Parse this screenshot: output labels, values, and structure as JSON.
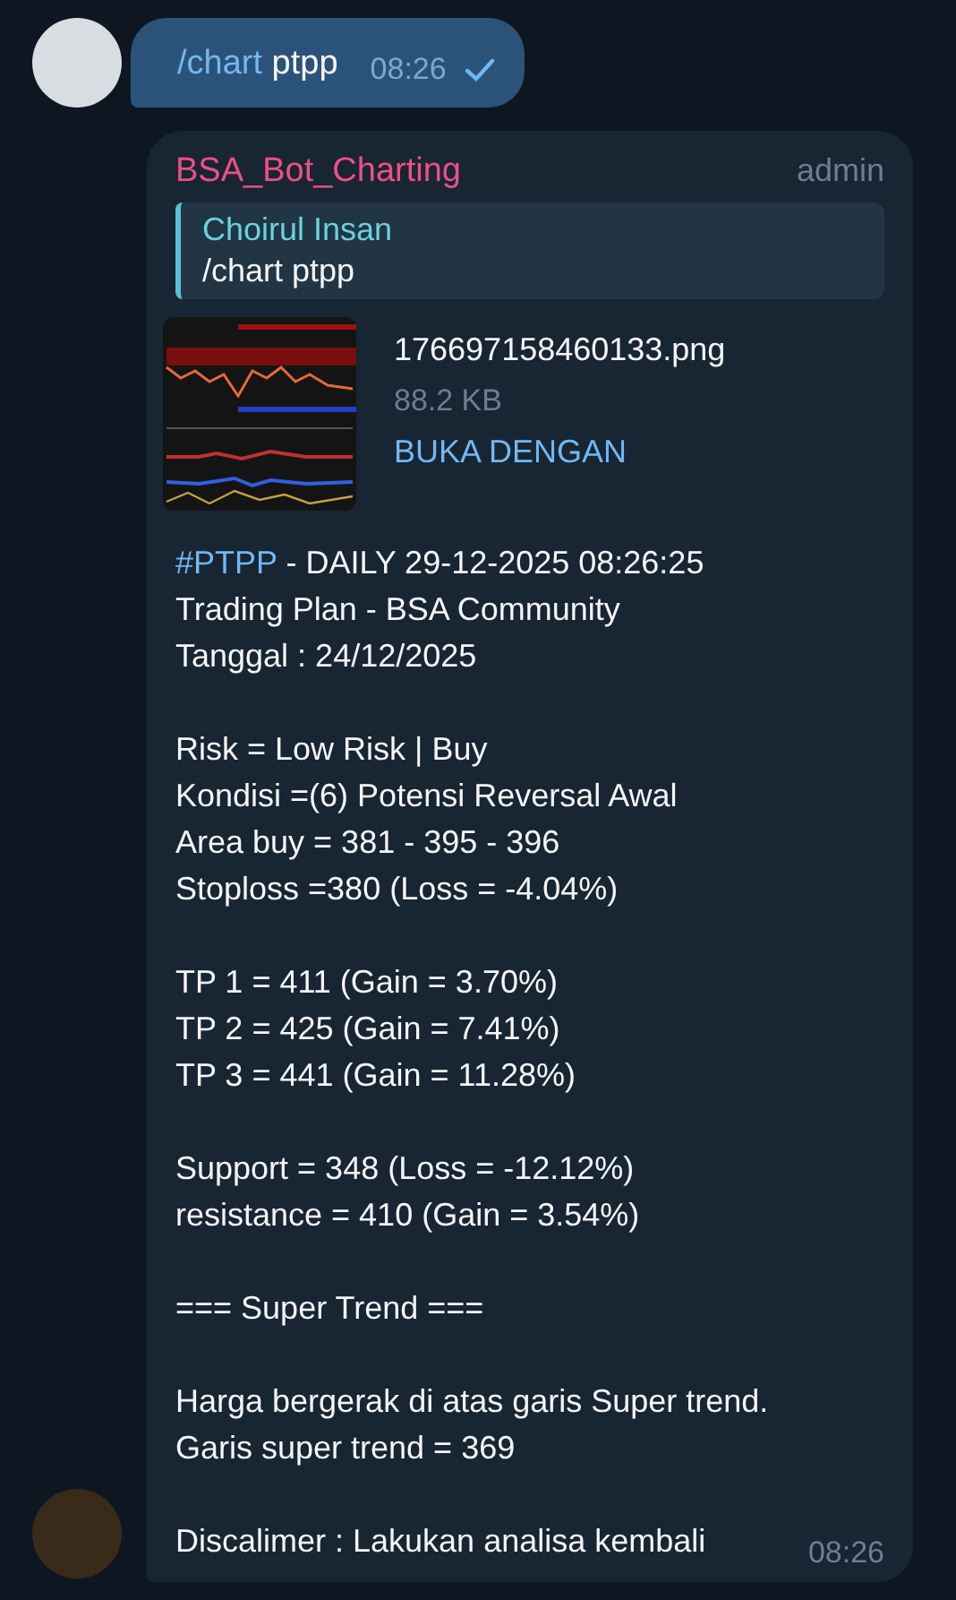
{
  "outgoing": {
    "command": "/chart",
    "text": "ptpp",
    "time": "08:26",
    "read": true
  },
  "incoming": {
    "sender": "BSA_Bot_Charting",
    "role": "admin",
    "reply": {
      "author": "Choirul Insan",
      "text": "/chart ptpp"
    },
    "file": {
      "name": "176697158460133.png",
      "size": "88.2 KB",
      "action": "BUKA DENGAN"
    },
    "hashtag": "#PTPP",
    "headline": " - DAILY 29-12-2025 08:26:25",
    "paragraphs": [
      [
        "Trading Plan - BSA Community",
        "Tanggal : 24/12/2025"
      ],
      [
        "Risk = Low Risk | Buy",
        "Kondisi =(6) Potensi Reversal Awal",
        "Area buy = 381 - 395 - 396",
        "Stoploss =380 (Loss = -4.04%)"
      ],
      [
        "TP 1 = 411 (Gain = 3.70%)",
        "TP 2 = 425 (Gain = 7.41%)",
        "TP 3 = 441 (Gain = 11.28%)"
      ],
      [
        "Support = 348 (Loss = -12.12%)",
        "resistance = 410 (Gain = 3.54%)"
      ],
      [
        "=== Super Trend ==="
      ],
      [
        "Harga bergerak di atas garis Super trend.",
        "Garis super trend = 369"
      ]
    ],
    "last_line": "Discalimer : Lakukan analisa kembali",
    "time": "08:26"
  }
}
